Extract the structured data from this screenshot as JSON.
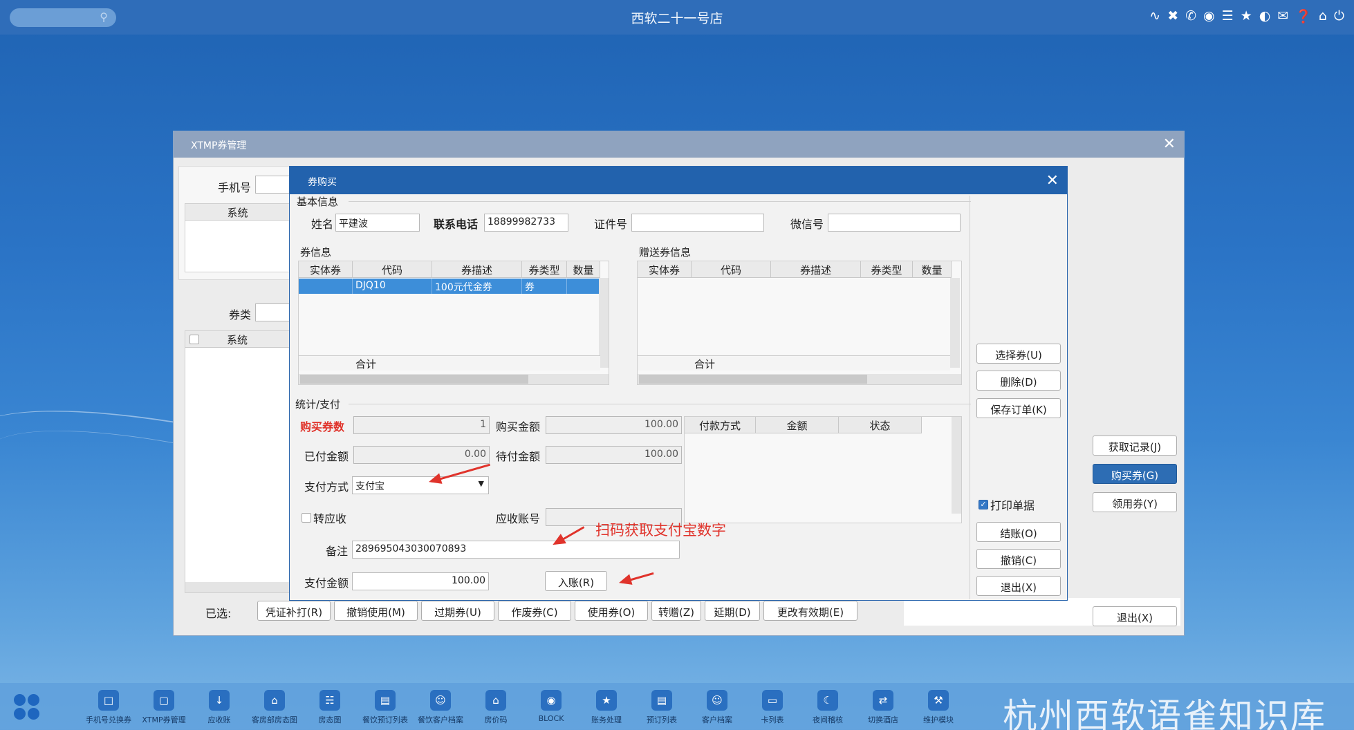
{
  "topbar": {
    "title": "西软二十一号店",
    "tray_icons": [
      "wifi-icon",
      "tools-icon",
      "phone-icon",
      "palette-icon",
      "menu-icon",
      "star-icon",
      "theme-icon",
      "mail-icon",
      "help-icon",
      "home-icon",
      "power-icon"
    ]
  },
  "main_window": {
    "title": "XTMP券管理",
    "phone_label": "手机号",
    "list_header_system": "系统",
    "coupon_type_label": "券类",
    "list2_header_system": "系统",
    "selected_label": "已选:",
    "bottom_buttons": [
      "凭证补打(R)",
      "撤销使用(M)",
      "过期券(U)",
      "作废券(C)",
      "使用券(O)",
      "转赠(Z)",
      "延期(D)",
      "更改有效期(E)"
    ],
    "right_buttons": {
      "get_record": "获取记录(J)",
      "buy": "购买券(G)",
      "collect": "领用券(Y)",
      "exit": "退出(X)"
    }
  },
  "dialog": {
    "title": "券购买",
    "basic": {
      "section": "基本信息",
      "name_label": "姓名",
      "name": "平建波",
      "phone_label": "联系电话",
      "phone": "18899982733",
      "id_label": "证件号",
      "id": "",
      "wechat_label": "微信号",
      "wechat": ""
    },
    "coupon": {
      "section": "券信息",
      "headers": [
        "实体券",
        "代码",
        "券描述",
        "券类型",
        "数量"
      ],
      "rows": [
        [
          "",
          "DJQ10",
          "100元代金券",
          "券",
          ""
        ]
      ],
      "total_label": "合计"
    },
    "gift": {
      "section": "赠送券信息",
      "headers": [
        "实体券",
        "代码",
        "券描述",
        "券类型",
        "数量"
      ],
      "total_label": "合计"
    },
    "stats": {
      "section": "统计/支付",
      "buy_count_label": "购买券数",
      "buy_count": "1",
      "buy_amount_label": "购买金额",
      "buy_amount": "100.00",
      "paid_label": "已付金额",
      "paid": "0.00",
      "pending_label": "待付金额",
      "pending": "100.00",
      "pay_method_label": "支付方式",
      "pay_method": "支付宝",
      "transfer_label": "转应收",
      "receivable_label": "应收账号",
      "receivable": "",
      "remark_label": "备注",
      "remark": "289695043030070893",
      "pay_amount_label": "支付金额",
      "pay_amount": "100.00",
      "post_button": "入账(R)",
      "pay_headers": [
        "付款方式",
        "金额",
        "状态"
      ]
    },
    "side_buttons": {
      "select": "选择券(U)",
      "delete": "删除(D)",
      "save": "保存订单(K)",
      "print_label": "打印单据",
      "settle": "结账(O)",
      "cancel": "撤销(C)",
      "exit": "退出(X)"
    },
    "annotation": "扫码获取支付宝数字"
  },
  "taskbar": {
    "items": [
      {
        "label": "手机号兑换券",
        "icon": "phone-coupon-icon"
      },
      {
        "label": "XTMP券管理",
        "icon": "coupon-icon"
      },
      {
        "label": "应收账",
        "icon": "receivable-icon"
      },
      {
        "label": "客房部房态图",
        "icon": "room-status-icon"
      },
      {
        "label": "房态图",
        "icon": "building-icon"
      },
      {
        "label": "餐饮预订列表",
        "icon": "list-icon"
      },
      {
        "label": "餐饮客户档案",
        "icon": "user-icon"
      },
      {
        "label": "房价码",
        "icon": "house-icon"
      },
      {
        "label": "BLOCK",
        "icon": "lock-icon"
      },
      {
        "label": "账务处理",
        "icon": "account-icon"
      },
      {
        "label": "预订列表",
        "icon": "booking-icon"
      },
      {
        "label": "客户档案",
        "icon": "profile-icon"
      },
      {
        "label": "卡列表",
        "icon": "card-icon"
      },
      {
        "label": "夜间稽核",
        "icon": "moon-icon"
      },
      {
        "label": "切换酒店",
        "icon": "switch-icon"
      },
      {
        "label": "维护模块",
        "icon": "wrench-icon"
      }
    ]
  },
  "watermark": "杭州西软语雀知识库"
}
